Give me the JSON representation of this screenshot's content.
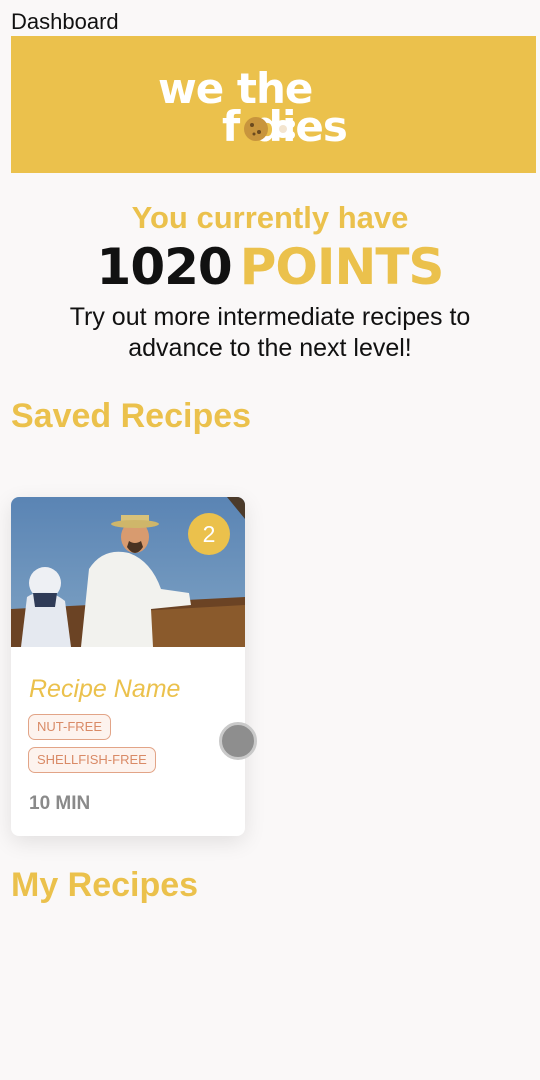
{
  "header": {
    "title": "Dashboard"
  },
  "banner": {
    "logo_line1": "we the",
    "logo_line2": "f  dies",
    "brand_color": "#ebc14c"
  },
  "points": {
    "subtitle": "You currently have",
    "value": "1020",
    "unit": "POINTS",
    "message": "Try out more intermediate recipes to advance to the next level!"
  },
  "saved_recipes": {
    "heading": "Saved Recipes",
    "cards": [
      {
        "badge": "2",
        "name": "Recipe Name",
        "tags": [
          "NUT-FREE",
          "SHELLFISH-FREE"
        ],
        "time": "10 MIN"
      }
    ]
  },
  "my_recipes": {
    "heading": "My Recipes"
  }
}
